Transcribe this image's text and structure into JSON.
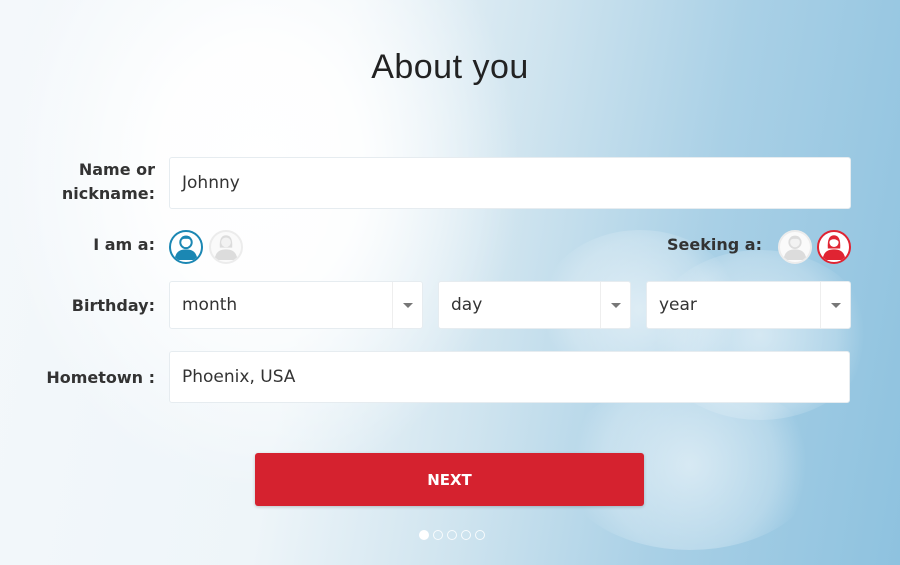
{
  "page": {
    "title": "About you"
  },
  "form": {
    "name": {
      "label_line1": "Name or",
      "label_line2": "nickname:",
      "value": "Johnny"
    },
    "i_am": {
      "label": "I am a:",
      "options": [
        {
          "name": "male",
          "icon": "male-avatar-icon",
          "selected": true
        },
        {
          "name": "female",
          "icon": "female-avatar-icon",
          "selected": false
        }
      ]
    },
    "seeking": {
      "label": "Seeking a:",
      "options": [
        {
          "name": "male",
          "icon": "male-avatar-icon",
          "selected": false
        },
        {
          "name": "female",
          "icon": "female-avatar-icon",
          "selected": true
        }
      ]
    },
    "birthday": {
      "label": "Birthday:",
      "month": "month",
      "day": "day",
      "year": "year"
    },
    "hometown": {
      "label": "Hometown :",
      "value": "Phoenix, USA"
    }
  },
  "actions": {
    "next_label": "NEXT"
  },
  "pagination": {
    "total_steps": 5,
    "current_step": 1
  },
  "colors": {
    "accent_red": "#d5222f",
    "male_selected": "#1b87b3",
    "female_selected": "#e02432",
    "unselected": "#e4e4e4"
  }
}
